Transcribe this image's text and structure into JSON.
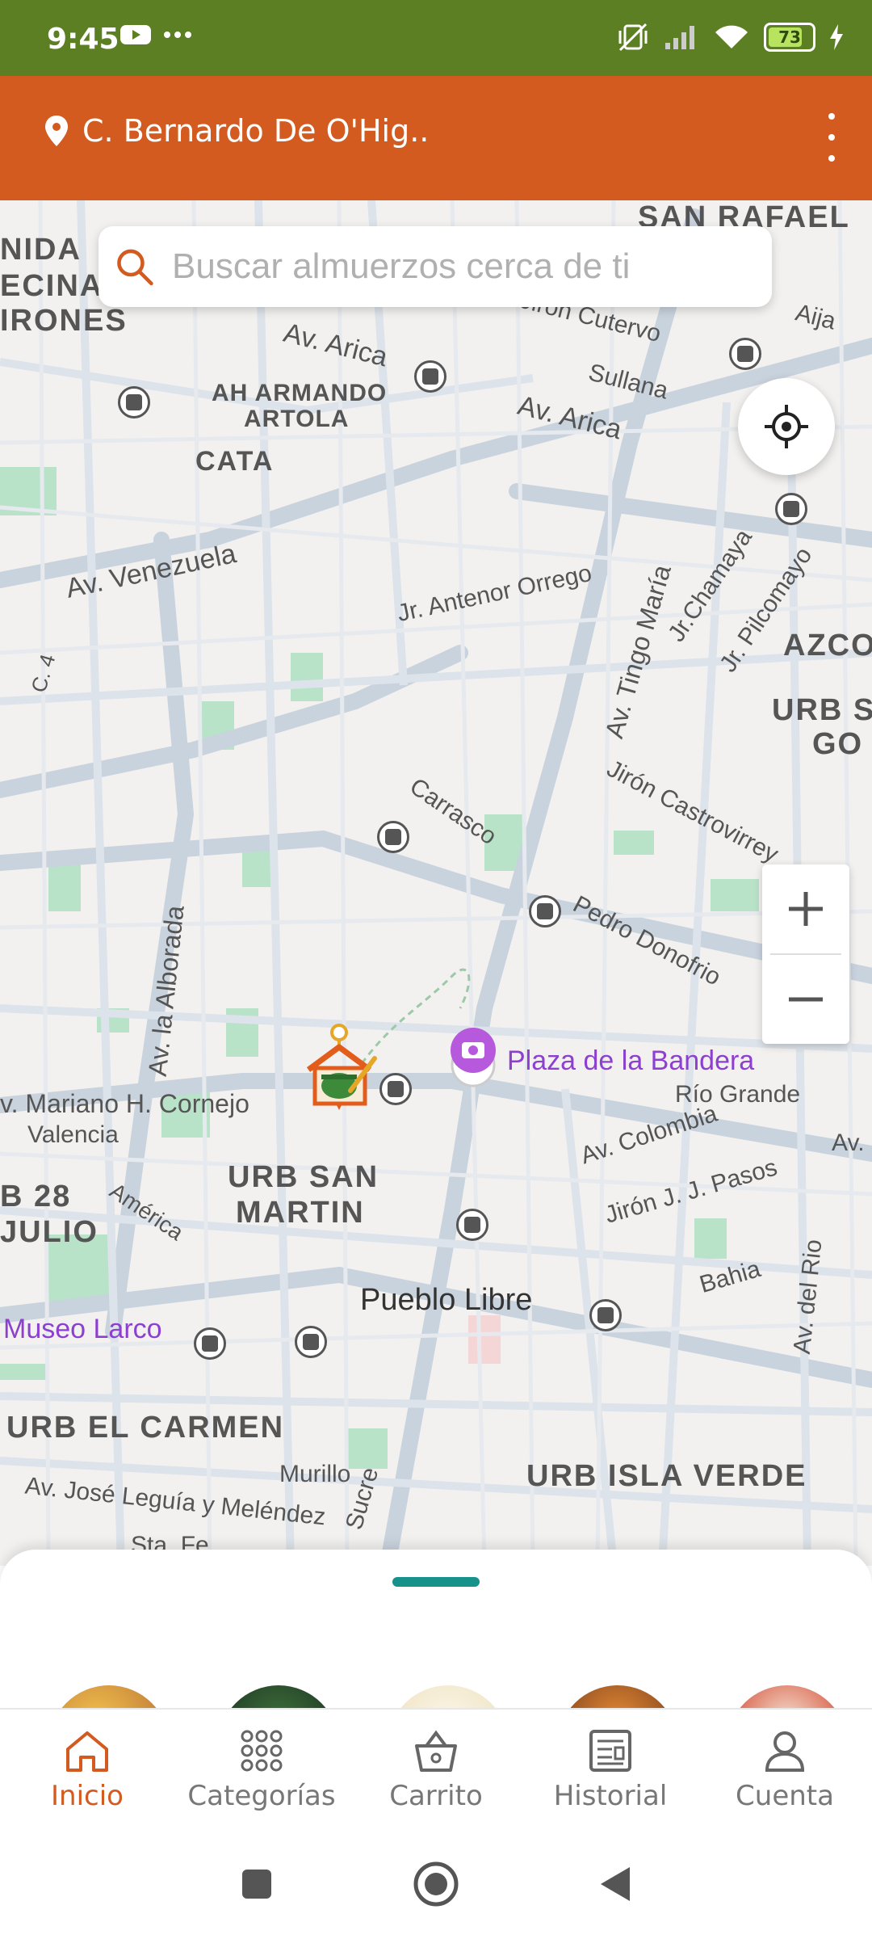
{
  "status": {
    "time": "9:45",
    "battery": "73"
  },
  "header": {
    "address": "C. Bernardo De O'Hig.."
  },
  "search": {
    "placeholder": "Buscar almuerzos cerca de ti"
  },
  "map": {
    "labels": {
      "nida": "NIDA",
      "ecina": "ECINA",
      "irones": "IRONES",
      "san_rafael": "SAN RAFAEL",
      "ah_armando": "AH ARMANDO",
      "artola": "ARTOLA",
      "cata": "CATA",
      "av_arica_1": "Av. Arica",
      "av_arica_2": "Av. Arica",
      "sullana": "Sullana",
      "aija": "Aija",
      "antonio_cutervo": "Jirón Cutervo",
      "av_venezuela": "Av. Venezuela",
      "jr_antenor_orrego": "Jr. Antenor Orrego",
      "av_tingo_maria": "Av. Tingo María",
      "jr_chamaya": "Jr.Chamaya",
      "jr_pilcomayo": "Jr. Pilcomayo",
      "azco": "AZCO",
      "urb_s": "URB S",
      "go": "GO",
      "c4": "C. 4",
      "carrasco": "Carrasco",
      "jiron_castrovirreyna": "Jirón Castrovirrey",
      "pedro_donofrio": "Pedro Donofrio",
      "av_la_alborada": "Av. la Alborada",
      "plaza_de_la_bandera": "Plaza de la Bandera",
      "rio_grande": "Río Grande",
      "av_mariano": "v. Mariano H. Cornejo",
      "valencia": "Valencia",
      "av_colombia": "Av. Colombia",
      "jiron_jj_pasos": "Jirón J. J. Pasos",
      "b28": "B 28",
      "julio": "JULIO",
      "america": "América",
      "urb_san": "URB SAN",
      "martin": "MARTIN",
      "bahia": "Bahia",
      "av_del_rio": "Av. del Rio",
      "pueblo_libre": "Pueblo Libre",
      "museo_larco": "Museo Larco",
      "urb_el_carmen": "URB EL CARMEN",
      "murillo": "Murillo",
      "urb_isla_verde": "URB ISLA VERDE",
      "av_jose_leguia": "Av. José Leguía y Meléndez",
      "sucre": "Sucre",
      "sta_fe": "Sta. Fe",
      "av_right": "Av."
    }
  },
  "nav": {
    "items": [
      {
        "label": "Inicio",
        "icon": "home-icon"
      },
      {
        "label": "Categorías",
        "icon": "grid-icon"
      },
      {
        "label": "Carrito",
        "icon": "basket-icon"
      },
      {
        "label": "Historial",
        "icon": "receipt-icon"
      },
      {
        "label": "Cuenta",
        "icon": "person-icon"
      }
    ]
  },
  "colors": {
    "status_bar": "#5b7f22",
    "app_bar": "#d35b20",
    "accent": "#16928a",
    "poi": "#8d3fd0"
  }
}
